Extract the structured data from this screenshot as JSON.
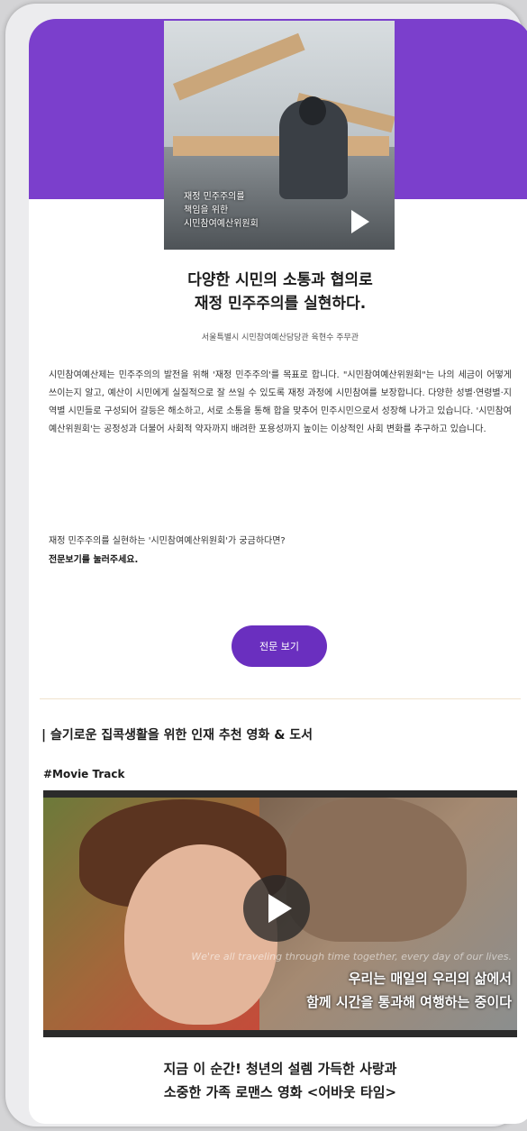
{
  "colors": {
    "accent": "#7b3fcc",
    "button": "#6a2fbf",
    "divider": "#f0e2cc"
  },
  "top_video": {
    "caption_lines": [
      "재정 민주주의를",
      "책임을 위한",
      "시민참여예산위원회"
    ],
    "play_icon": "play-icon"
  },
  "article": {
    "headline_line1": "다양한 시민의 소통과 협의로",
    "headline_line2": "재정 민주주의를 실현하다.",
    "byline": "서울특별시 시민참여예산담당관 육현수 주무관",
    "body": "시민참여예산제는 민주주의의 발전을 위해 '재정 민주주의'를 목표로 합니다. \"시민참여예산위원회\"는 나의 세금이 어떻게 쓰이는지 알고, 예산이 시민에게 실질적으로 잘 쓰일 수 있도록 재정 과정에 시민참여를 보장합니다. 다양한 성별·연령별·지역별 시민들로 구성되어 갈등은 해소하고, 서로 소통을 통해 합을 맞추어 민주시민으로서 성장해 나가고 있습니다. '시민참여예산위원회'는 공정성과 더불어 사회적 약자까지 배려한 포용성까지 높이는 이상적인 사회 변화를 추구하고 있습니다.",
    "question": "재정 민주주의를 실현하는 '시민참여예산위원회'가 궁금하다면?",
    "question_bold": "전문보기를 눌러주세요.",
    "button_label": "전문 보기"
  },
  "recommend": {
    "section_title": "| 슬기로운 집콕생활을 위한 인재 추천 영화 & 도서",
    "tag": "#Movie Track",
    "subtitle_en": "We're all traveling through time together, every day of our lives.",
    "subtitle_ko_line1": "우리는 매일의 우리의 삶에서",
    "subtitle_ko_line2": "함께 시간을 통과해 여행하는 중이다",
    "movie_title_line1": "지금 이 순간! 청년의 설렘 가득한 사랑과",
    "movie_title_line2": "소중한 가족 로맨스 영화 <어바웃 타임>"
  }
}
